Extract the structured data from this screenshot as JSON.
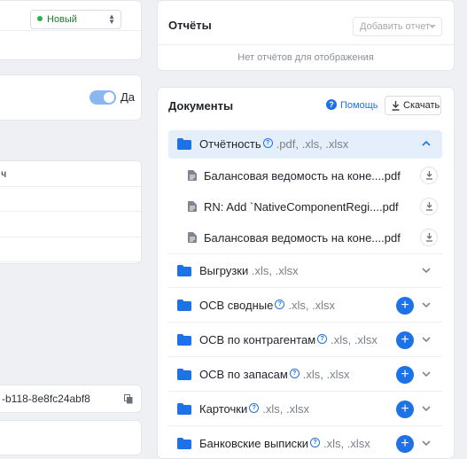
{
  "left": {
    "status_select": "Новый",
    "toggle_label": "Да",
    "table_rows": [
      "ч",
      "",
      "",
      ""
    ],
    "uuid": "-b118-8e8fc24abf8"
  },
  "reports": {
    "title": "Отчёты",
    "add_report": "Добавить отчет",
    "empty_text": "Нет отчётов для отображения"
  },
  "documents": {
    "title": "Документы",
    "help_label": "Помощь",
    "download_label": "Скачать",
    "folders": [
      {
        "name": "Отчётность",
        "ext": ".pdf, .xls, .xlsx"
      },
      {
        "name": "Выгрузки",
        "ext": ".xls, .xlsx"
      },
      {
        "name": "ОСВ сводные",
        "ext": ".xls, .xlsx"
      },
      {
        "name": "ОСВ по контрагентам",
        "ext": ".xls, .xlsx"
      },
      {
        "name": "ОСВ по запасам",
        "ext": ".xls, .xlsx"
      },
      {
        "name": "Карточки",
        "ext": ".xls, .xlsx"
      },
      {
        "name": "Банковские выписки",
        "ext": ".xls, .xlsx"
      }
    ],
    "files": [
      "Балансовая ведомость на коне....pdf",
      "RN: Add `NativeComponentRegi....pdf",
      "Балансовая ведомость на коне....pdf"
    ]
  },
  "colors": {
    "accent": "#1d72e8",
    "status_green": "#25b34b"
  }
}
